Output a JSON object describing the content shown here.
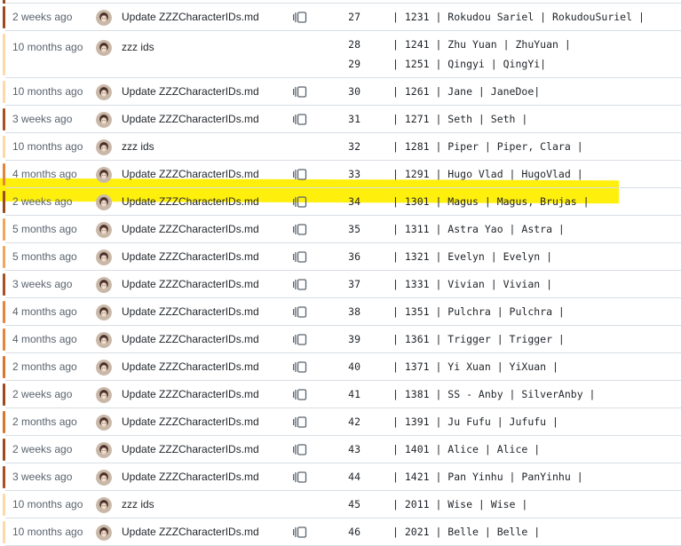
{
  "colors": {
    "age_recent": "#9a4a1c",
    "age_mid": "#d9752c",
    "age_old_light": "#f0a65c",
    "age_oldest": "#fbd9a8",
    "highlight": "#ffee00",
    "text_muted": "#59636e",
    "text": "#1f2328",
    "border": "#d8dee4"
  },
  "blame": {
    "rows": [
      {
        "age": "2 weeks ago",
        "age_color": "#9a4a1c",
        "message": "Update ZZZCharacterIDs.md",
        "reblame": true,
        "lines": [
          {
            "num": "27",
            "code": "| 1231 | Rokudou Sariel | RokudouSuriel |"
          }
        ]
      },
      {
        "age": "10 months ago",
        "age_color": "#fbd9a8",
        "message": "zzz ids",
        "reblame": false,
        "lines": [
          {
            "num": "28",
            "code": "| 1241 | Zhu Yuan | ZhuYuan |"
          },
          {
            "num": "29",
            "code": "| 1251 | Qingyi | QingYi|"
          }
        ]
      },
      {
        "age": "10 months ago",
        "age_color": "#fbd9a8",
        "message": "Update ZZZCharacterIDs.md",
        "reblame": true,
        "lines": [
          {
            "num": "30",
            "code": "| 1261 | Jane | JaneDoe|"
          }
        ]
      },
      {
        "age": "3 weeks ago",
        "age_color": "#a8501f",
        "message": "Update ZZZCharacterIDs.md",
        "reblame": true,
        "lines": [
          {
            "num": "31",
            "code": "| 1271 | Seth | Seth |"
          }
        ]
      },
      {
        "age": "10 months ago",
        "age_color": "#fbd9a8",
        "message": "zzz ids",
        "reblame": false,
        "lines": [
          {
            "num": "32",
            "code": "| 1281 | Piper | Piper, Clara |"
          }
        ]
      },
      {
        "age": "4 months ago",
        "age_color": "#e8843a",
        "message": "Update ZZZCharacterIDs.md",
        "reblame": true,
        "lines": [
          {
            "num": "33",
            "code": "| 1291 | Hugo Vlad | HugoVlad |"
          }
        ]
      },
      {
        "age": "2 weeks ago",
        "age_color": "#9a4a1c",
        "message": "Update ZZZCharacterIDs.md",
        "reblame": true,
        "lines": [
          {
            "num": "34",
            "code": "| 1301 | Magus | Magus, Brujas |"
          }
        ]
      },
      {
        "age": "5 months ago",
        "age_color": "#f0a65c",
        "message": "Update ZZZCharacterIDs.md",
        "reblame": true,
        "lines": [
          {
            "num": "35",
            "code": "| 1311 | Astra Yao | Astra |"
          }
        ]
      },
      {
        "age": "5 months ago",
        "age_color": "#f0a65c",
        "message": "Update ZZZCharacterIDs.md",
        "reblame": true,
        "lines": [
          {
            "num": "36",
            "code": "| 1321 | Evelyn | Evelyn |"
          }
        ]
      },
      {
        "age": "3 weeks ago",
        "age_color": "#a8501f",
        "message": "Update ZZZCharacterIDs.md",
        "reblame": true,
        "lines": [
          {
            "num": "37",
            "code": "| 1331 | Vivian | Vivian |"
          }
        ]
      },
      {
        "age": "4 months ago",
        "age_color": "#e8843a",
        "message": "Update ZZZCharacterIDs.md",
        "reblame": true,
        "lines": [
          {
            "num": "38",
            "code": "| 1351 | Pulchra | Pulchra |"
          }
        ]
      },
      {
        "age": "4 months ago",
        "age_color": "#e8843a",
        "message": "Update ZZZCharacterIDs.md",
        "reblame": true,
        "lines": [
          {
            "num": "39",
            "code": "| 1361 | Trigger | Trigger |"
          }
        ]
      },
      {
        "age": "2 months ago",
        "age_color": "#d9752c",
        "message": "Update ZZZCharacterIDs.md",
        "reblame": true,
        "lines": [
          {
            "num": "40",
            "code": "| 1371 | Yi Xuan | YiXuan |"
          }
        ]
      },
      {
        "age": "2 weeks ago",
        "age_color": "#9a4a1c",
        "message": "Update ZZZCharacterIDs.md",
        "reblame": true,
        "lines": [
          {
            "num": "41",
            "code": "| 1381 | SS - Anby | SilverAnby |"
          }
        ]
      },
      {
        "age": "2 months ago",
        "age_color": "#d9752c",
        "message": "Update ZZZCharacterIDs.md",
        "reblame": true,
        "lines": [
          {
            "num": "42",
            "code": "| 1391 | Ju Fufu | Jufufu |"
          }
        ]
      },
      {
        "age": "2 weeks ago",
        "age_color": "#9a4a1c",
        "message": "Update ZZZCharacterIDs.md",
        "reblame": true,
        "lines": [
          {
            "num": "43",
            "code": "| 1401 | Alice | Alice |"
          }
        ]
      },
      {
        "age": "3 weeks ago",
        "age_color": "#a8501f",
        "message": "Update ZZZCharacterIDs.md",
        "reblame": true,
        "lines": [
          {
            "num": "44",
            "code": "| 1421 | Pan Yinhu | PanYinhu |"
          }
        ]
      },
      {
        "age": "10 months ago",
        "age_color": "#fbd9a8",
        "message": "zzz ids",
        "reblame": false,
        "lines": [
          {
            "num": "45",
            "code": "| 2011 | Wise | Wise |"
          }
        ]
      },
      {
        "age": "10 months ago",
        "age_color": "#fbd9a8",
        "message": "Update ZZZCharacterIDs.md",
        "reblame": true,
        "lines": [
          {
            "num": "46",
            "code": "| 2021 | Belle | Belle |"
          }
        ]
      }
    ]
  }
}
